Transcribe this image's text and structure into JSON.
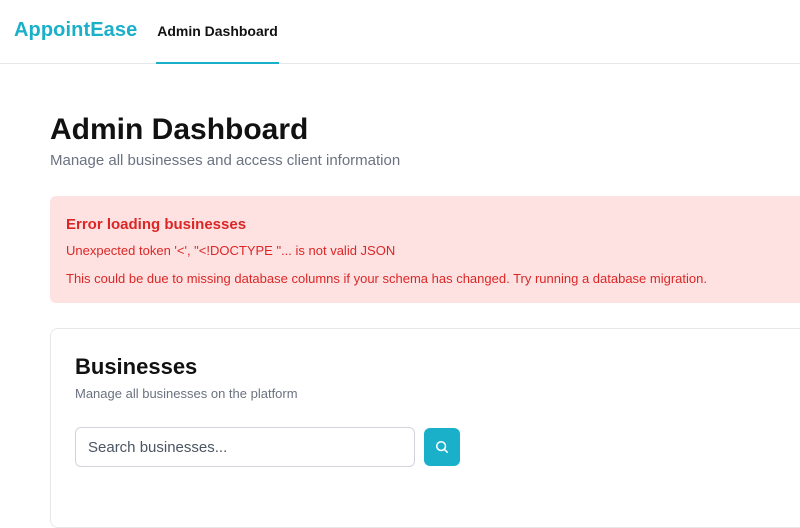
{
  "header": {
    "brand": "AppointEase",
    "nav_tab": "Admin Dashboard"
  },
  "page": {
    "title": "Admin Dashboard",
    "subtitle": "Manage all businesses and access client information"
  },
  "error": {
    "title": "Error loading businesses",
    "message": "Unexpected token '<', \"<!DOCTYPE \"... is not valid JSON",
    "hint": "This could be due to missing database columns if your schema has changed. Try running a database migration."
  },
  "businesses_card": {
    "title": "Businesses",
    "subtitle": "Manage all businesses on the platform",
    "search": {
      "placeholder": "Search businesses...",
      "value": ""
    },
    "search_button_icon": "search-icon"
  },
  "colors": {
    "accent": "#1ab0c9",
    "error_bg": "#fee2e2",
    "error_text": "#dc2626",
    "muted_text": "#6b7280"
  }
}
